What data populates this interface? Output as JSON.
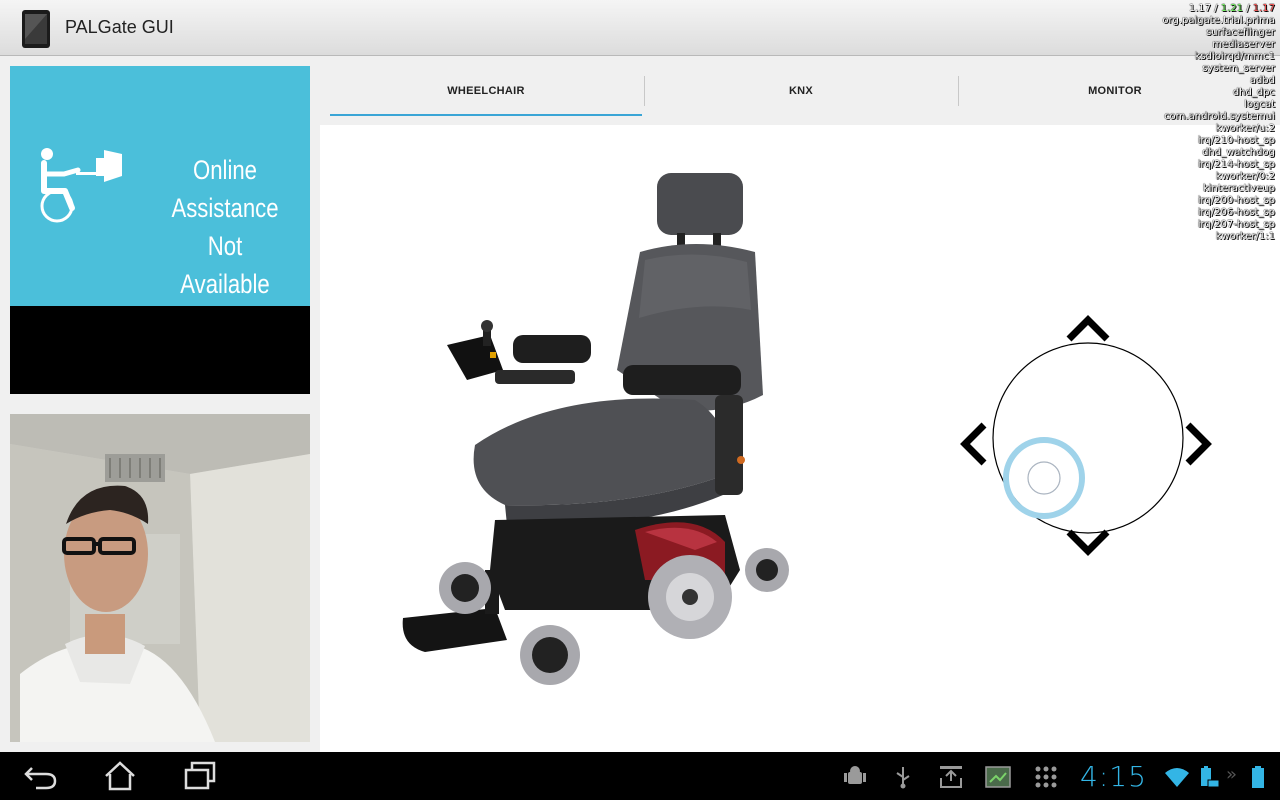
{
  "app": {
    "title": "PALGate GUI"
  },
  "overlay": {
    "load_a": "1.17",
    "load_b": "1.21",
    "load_c": "1.17",
    "processes": [
      "org.palgate.trial.prima",
      "surfaceflinger",
      "mediaserver",
      "ksdioirqd/mmc1",
      "system_server",
      "adbd",
      "dhd_dpc",
      "logcat",
      "com.android.systemui",
      "kworker/u:2",
      "irq/210-host_sp",
      "dhd_watchdog",
      "irq/214-host_sp",
      "kworker/0:2",
      "kinteractiveup",
      "irq/200-host_sp",
      "irq/206-host_sp",
      "irq/207-host_sp",
      "kworker/1:1"
    ]
  },
  "assistance": {
    "line1": "Online Assistance",
    "line2": "Not Available",
    "bg_color": "#4bbfda"
  },
  "tabs": [
    {
      "label": "WHEELCHAIR",
      "active": true
    },
    {
      "label": "KNX",
      "active": false
    },
    {
      "label": "MONITOR",
      "active": false
    }
  ],
  "accent_color": "#3aa5d6",
  "joystick": {
    "icons": [
      "chevron-up-icon",
      "chevron-down-icon",
      "chevron-left-icon",
      "chevron-right-icon"
    ]
  },
  "navbar": {
    "clock": "4:15"
  }
}
